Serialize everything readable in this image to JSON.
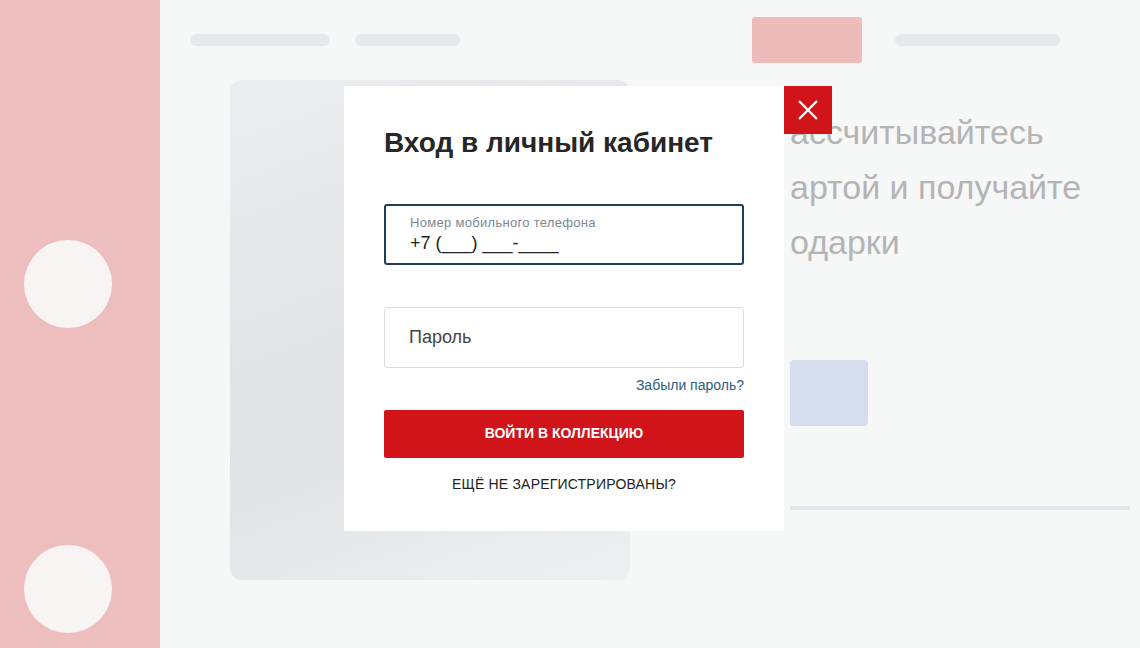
{
  "background": {
    "heading_lines": [
      "ассчитывайтесь",
      "артой и получайте",
      "одарки"
    ]
  },
  "modal": {
    "title": "Вход в личный кабинет",
    "phone": {
      "label": "Номер мобильного телефона",
      "value": "+7 (___) ___-____",
      "focused": true
    },
    "password": {
      "placeholder": "Пароль"
    },
    "forgot_link": "Забыли пароль?",
    "submit": "ВОЙТИ В КОЛЛЕКЦИЮ",
    "register_link": "ЕЩЁ НЕ ЗАРЕГИСТРИРОВАНЫ?"
  }
}
